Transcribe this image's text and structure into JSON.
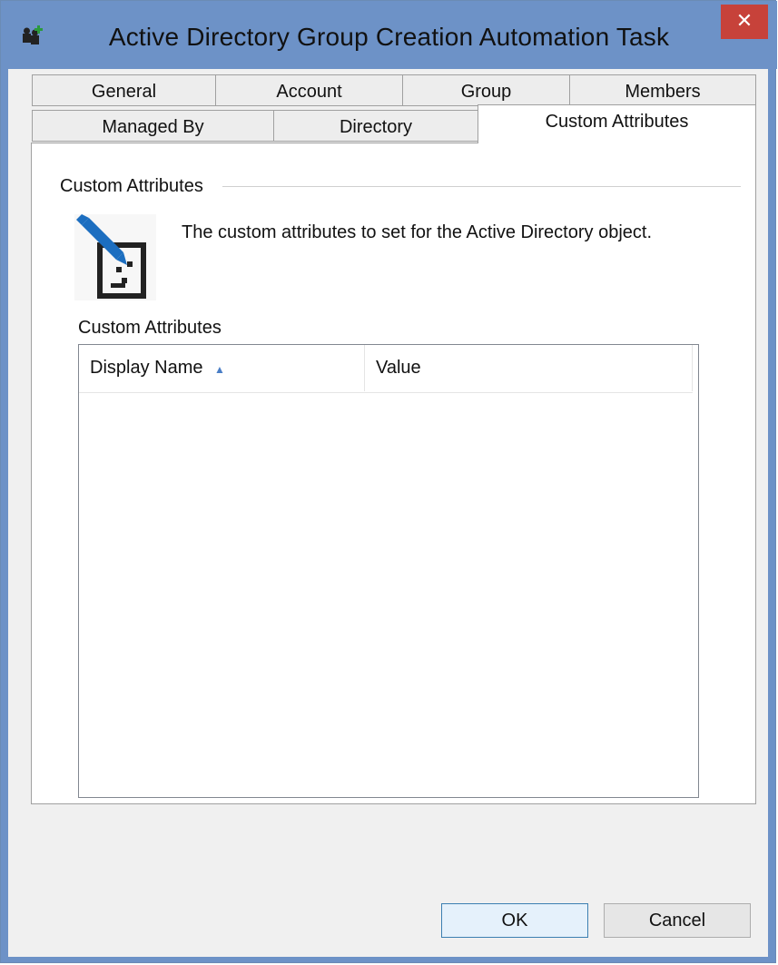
{
  "window": {
    "title": "Active Directory Group Creation Automation Task",
    "close_label": "✕",
    "app_icon": "group-add-icon",
    "accent_color": "#6d92c7",
    "close_color": "#c7423a"
  },
  "tabs": {
    "row1": [
      "General",
      "Account",
      "Group",
      "Members"
    ],
    "row2": [
      "Managed By",
      "Directory",
      "Custom Attributes"
    ],
    "active": "Custom Attributes"
  },
  "panel": {
    "group_label": "Custom Attributes",
    "description": "The custom attributes to set for the Active Directory object.",
    "icon": "edit-attributes-icon",
    "list_label": "Custom Attributes",
    "columns": [
      "Display Name",
      "Value"
    ],
    "sort_indicator": "▲",
    "rows": []
  },
  "buttons": {
    "ok": "OK",
    "cancel": "Cancel"
  }
}
